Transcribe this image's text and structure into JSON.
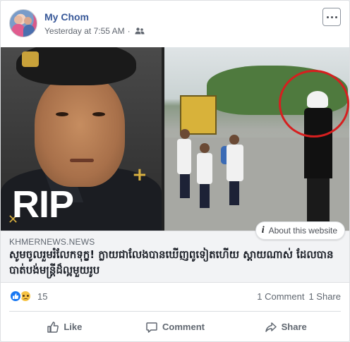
{
  "post": {
    "author": "My Chom",
    "timestamp": "Yesterday at 7:55 AM",
    "separator": "·",
    "audience_icon": "friends-icon",
    "more_icon": "more-options-icon"
  },
  "link": {
    "image_overlay_text": "RIP",
    "domain": "KHMERNEWS.NEWS",
    "title": "សូមចូលរួមរំលែកទុក្ខ! ក្លាយជាលែងបានឃើញពូទៀតហើយ ស្តាយណាស់ ដែលបានបាត់បង់មន្ត្រីដ៏ល្អមួយរូប",
    "about_label": "About this website",
    "about_icon": "info-icon"
  },
  "reactions": {
    "count": "15",
    "icons": [
      "like-icon",
      "sad-icon"
    ],
    "comments": "1 Comment",
    "shares": "1 Share"
  },
  "actions": {
    "like": "Like",
    "comment": "Comment",
    "share": "Share"
  },
  "colors": {
    "name_link": "#385898",
    "like_blue": "#1877f2",
    "highlight_circle": "#d61f1f"
  }
}
